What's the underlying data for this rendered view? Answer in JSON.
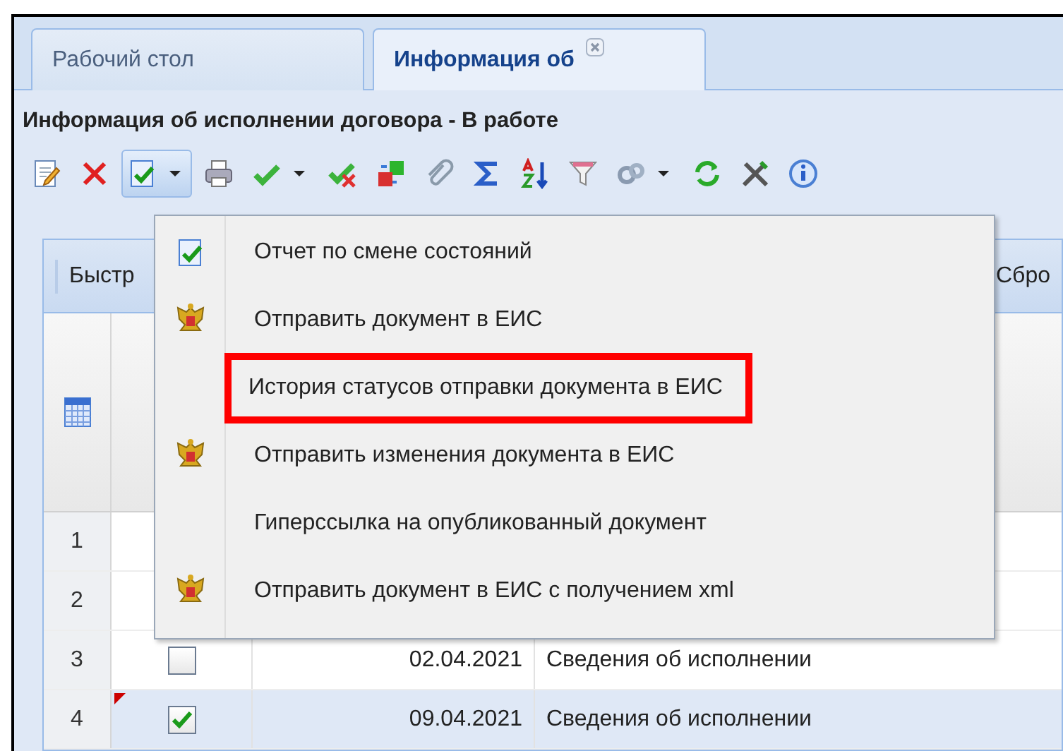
{
  "tabs": [
    {
      "label": "Рабочий стол",
      "selected": false,
      "closable": false
    },
    {
      "label": "Информация об",
      "selected": true,
      "closable": true
    }
  ],
  "panel_title": "Информация об исполнении договора - В работе",
  "toolbar": [
    {
      "kind": "edit"
    },
    {
      "kind": "delete"
    },
    {
      "kind": "status-report",
      "dropdown": true,
      "pressed": true
    },
    {
      "kind": "print"
    },
    {
      "kind": "approve",
      "dropdown": true
    },
    {
      "kind": "unapprove"
    },
    {
      "kind": "transfer"
    },
    {
      "kind": "attach"
    },
    {
      "kind": "sum"
    },
    {
      "kind": "sort"
    },
    {
      "kind": "filter"
    },
    {
      "kind": "links",
      "dropdown": true
    },
    {
      "kind": "refresh"
    },
    {
      "kind": "tools"
    },
    {
      "kind": "info"
    }
  ],
  "filter_bar": {
    "quick_search": "Быстр",
    "reset": "Сбро"
  },
  "grid": {
    "rows": [
      {
        "number": "1",
        "selected": false
      },
      {
        "number": "2",
        "selected": false
      },
      {
        "number": "3",
        "selected": false,
        "checked": false,
        "modified": false,
        "date": "02.04.2021",
        "name": "Сведения об исполнении"
      },
      {
        "number": "4",
        "selected": true,
        "checked": true,
        "modified": true,
        "date": "09.04.2021",
        "name": "Сведения об исполнении"
      }
    ]
  },
  "menu": {
    "items": [
      {
        "label": "Отчет по смене состояний",
        "kind": "report",
        "highlighted": false
      },
      {
        "label": "Отправить документ в ЕИС",
        "kind": "emblem",
        "highlighted": false
      },
      {
        "label": "История статусов отправки документа в ЕИС",
        "kind": "plain",
        "highlighted": true
      },
      {
        "label": "Отправить изменения документа в ЕИС",
        "kind": "emblem",
        "highlighted": false
      },
      {
        "label": "Гиперссылка на опубликованный документ",
        "kind": "plain",
        "highlighted": false
      },
      {
        "label": "Отправить документ в ЕИС с получением xml",
        "kind": "emblem",
        "highlighted": false
      }
    ]
  }
}
